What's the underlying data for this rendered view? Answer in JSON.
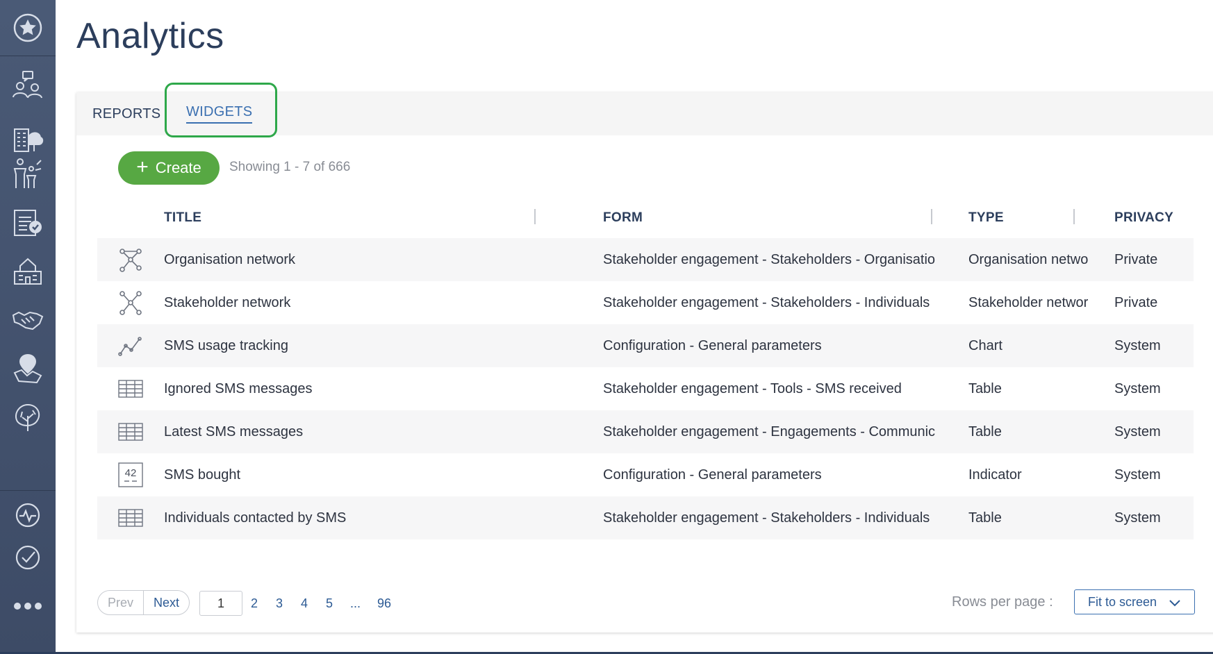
{
  "page": {
    "title": "Analytics"
  },
  "sidebar": {
    "items": [
      {
        "icon": "star-circle-icon"
      },
      {
        "icon": "people-chat-icon"
      },
      {
        "icon": "buildings-tree-icon"
      },
      {
        "icon": "family-icon"
      },
      {
        "icon": "checklist-icon"
      },
      {
        "icon": "community-building-icon"
      },
      {
        "icon": "handshake-icon"
      },
      {
        "icon": "map-pin-icon"
      },
      {
        "icon": "leaf-tree-icon"
      },
      {
        "icon": "pulse-icon"
      },
      {
        "icon": "check-circle-icon"
      },
      {
        "icon": "more-dots-icon"
      }
    ]
  },
  "tabs": {
    "reports": "REPORTS",
    "widgets": "WIDGETS",
    "active": "WIDGETS"
  },
  "toolbar": {
    "create_label": "Create",
    "showing": "Showing 1 - 7 of 666"
  },
  "table": {
    "columns": {
      "title": "TITLE",
      "form": "FORM",
      "type": "TYPE",
      "privacy": "PRIVACY"
    },
    "rows": [
      {
        "icon": "network-icon",
        "title": "Organisation network",
        "form": "Stakeholder engagement - Stakeholders - Organisatio",
        "type": "Organisation netwo",
        "privacy": "Private"
      },
      {
        "icon": "network-icon",
        "title": "Stakeholder network",
        "form": "Stakeholder engagement - Stakeholders - Individuals",
        "type": "Stakeholder networ",
        "privacy": "Private"
      },
      {
        "icon": "line-chart-icon",
        "title": "SMS usage tracking",
        "form": "Configuration - General parameters",
        "type": "Chart",
        "privacy": "System"
      },
      {
        "icon": "table-icon",
        "title": "Ignored SMS messages",
        "form": "Stakeholder engagement - Tools - SMS received",
        "type": "Table",
        "privacy": "System"
      },
      {
        "icon": "table-icon",
        "title": "Latest SMS messages",
        "form": "Stakeholder engagement - Engagements - Communic",
        "type": "Table",
        "privacy": "System"
      },
      {
        "icon": "indicator-icon",
        "indicator_value": "42",
        "title": "SMS bought",
        "form": "Configuration - General parameters",
        "type": "Indicator",
        "privacy": "System"
      },
      {
        "icon": "table-icon",
        "title": "Individuals contacted by SMS",
        "form": "Stakeholder engagement - Stakeholders - Individuals",
        "type": "Table",
        "privacy": "System"
      }
    ]
  },
  "pagination": {
    "prev": "Prev",
    "next": "Next",
    "current": "1",
    "pages": [
      "2",
      "3",
      "4",
      "5",
      "...",
      "96"
    ]
  },
  "rows_per_page": {
    "label": "Rows per page :",
    "value": "Fit to screen"
  },
  "colors": {
    "accent": "#3a6fb0",
    "create": "#57a843",
    "highlight": "#2ea84a",
    "sidebar": "#435370"
  }
}
